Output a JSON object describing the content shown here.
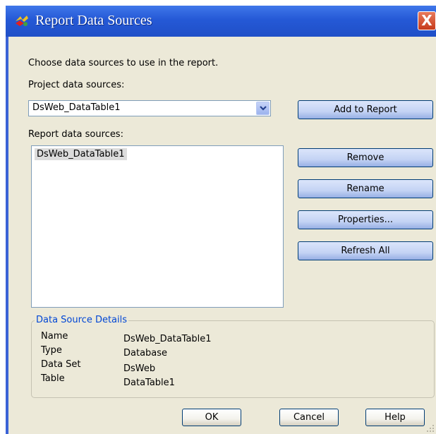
{
  "window": {
    "title": "Report Data Sources",
    "close_label": "X"
  },
  "labels": {
    "instruction": "Choose data sources to use in the report.",
    "project_sources": "Project data sources:",
    "report_sources": "Report data sources:"
  },
  "project_combo": {
    "selected": "DsWeb_DataTable1"
  },
  "report_list": {
    "items": [
      "DsWeb_DataTable1"
    ]
  },
  "buttons": {
    "add_to_report": "Add to Report",
    "remove": "Remove",
    "rename": "Rename",
    "properties": "Properties...",
    "refresh_all": "Refresh All",
    "ok": "OK",
    "cancel": "Cancel",
    "help": "Help"
  },
  "details": {
    "group_title": "Data Source Details",
    "rows": [
      {
        "key": "Name",
        "value": "DsWeb_DataTable1"
      },
      {
        "key": "Type",
        "value": "Database"
      },
      {
        "key": "Data Set",
        "value": "DsWeb"
      },
      {
        "key": "Table",
        "value": "DataTable1"
      }
    ]
  },
  "colors": {
    "titlebar": "#2559d6",
    "dialog_face": "#ece9d8",
    "group_title": "#0046d5",
    "selection": "#dcdcdc"
  },
  "icons": [
    "app-icon",
    "close-icon",
    "chevron-down-icon",
    "resize-grip-icon"
  ]
}
